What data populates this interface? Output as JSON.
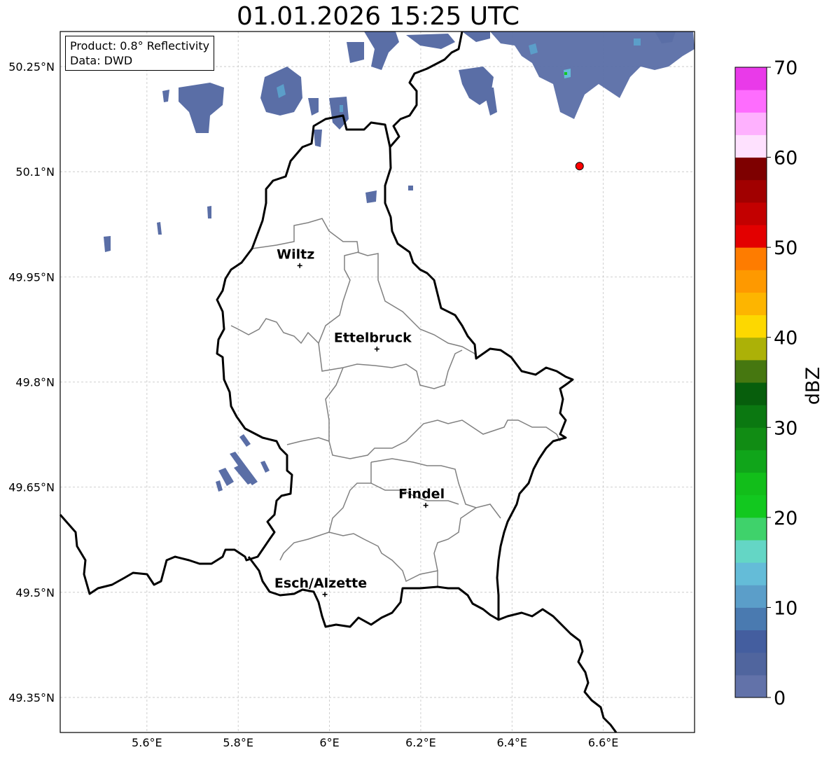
{
  "title": "01.01.2026 15:25 UTC",
  "info": {
    "product": "Product: 0.8° Reflectivity",
    "data_source": "Data: DWD"
  },
  "map": {
    "lon_range": [
      5.41,
      6.8
    ],
    "lat_range": [
      49.3,
      50.3
    ],
    "lon_ticks": [
      "5.6°E",
      "5.8°E",
      "6°E",
      "6.2°E",
      "6.4°E",
      "6.6°E"
    ],
    "lat_ticks": [
      "50.25°N",
      "50.1°N",
      "49.95°N",
      "49.8°N",
      "49.65°N",
      "49.5°N",
      "49.35°N"
    ],
    "cities": [
      {
        "name": "Wiltz",
        "lon": 5.935,
        "lat": 49.966
      },
      {
        "name": "Ettelbruck",
        "lon": 6.104,
        "lat": 49.847
      },
      {
        "name": "Findel",
        "lon": 6.211,
        "lat": 49.624
      },
      {
        "name": "Esch/Alzette",
        "lon": 5.99,
        "lat": 49.497
      }
    ],
    "red_marker": {
      "lon": 6.548,
      "lat": 50.108
    }
  },
  "colorbar": {
    "label": "dBZ",
    "ticks": [
      "0",
      "10",
      "20",
      "30",
      "40",
      "50",
      "60",
      "70"
    ],
    "colors": [
      "#6272a9",
      "#50659e",
      "#445e9f",
      "#4a7ab0",
      "#5b9ec9",
      "#64bcd8",
      "#64d6c5",
      "#3fd26b",
      "#12c81f",
      "#12be1a",
      "#10a51a",
      "#118c14",
      "#0b7811",
      "#075e0c",
      "#467710",
      "#acb107",
      "#fdd800",
      "#fdb500",
      "#fe9900",
      "#fe7c00",
      "#e30000",
      "#c30000",
      "#a10000",
      "#7e0000",
      "#fee1fe",
      "#feb1fe",
      "#fe6dfe",
      "#e93ae9"
    ]
  }
}
